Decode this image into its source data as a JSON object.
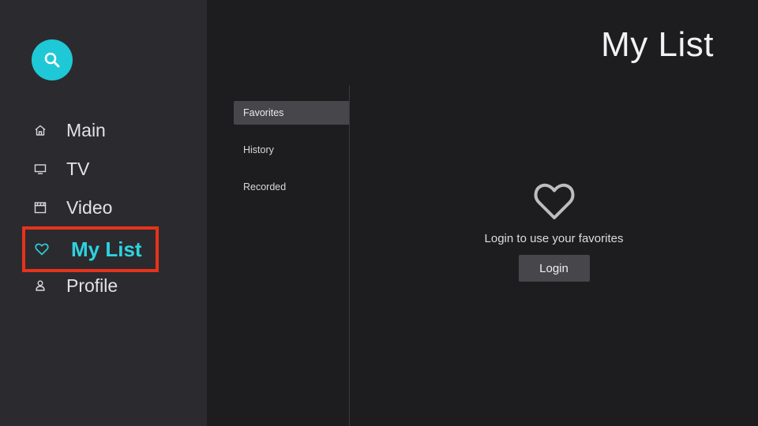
{
  "sidebar": {
    "items": [
      {
        "label": "Main",
        "icon": "home-icon"
      },
      {
        "label": "TV",
        "icon": "tv-icon"
      },
      {
        "label": "Video",
        "icon": "clapperboard-icon"
      },
      {
        "label": "My List",
        "icon": "heart-icon"
      },
      {
        "label": "Profile",
        "icon": "user-icon"
      }
    ],
    "active_index": 3,
    "search_icon": "search-icon"
  },
  "header": {
    "title": "My List"
  },
  "subnav": {
    "items": [
      {
        "label": "Favorites"
      },
      {
        "label": "History"
      },
      {
        "label": "Recorded"
      }
    ],
    "selected_index": 0
  },
  "main": {
    "empty_icon": "heart-outline-icon",
    "message": "Login to use your favorites",
    "login_label": "Login"
  },
  "colors": {
    "accent": "#1fc8d6",
    "highlight_border": "#e8321b",
    "sidebar_bg": "#2b2b2f",
    "content_bg": "#1d1d1f"
  }
}
